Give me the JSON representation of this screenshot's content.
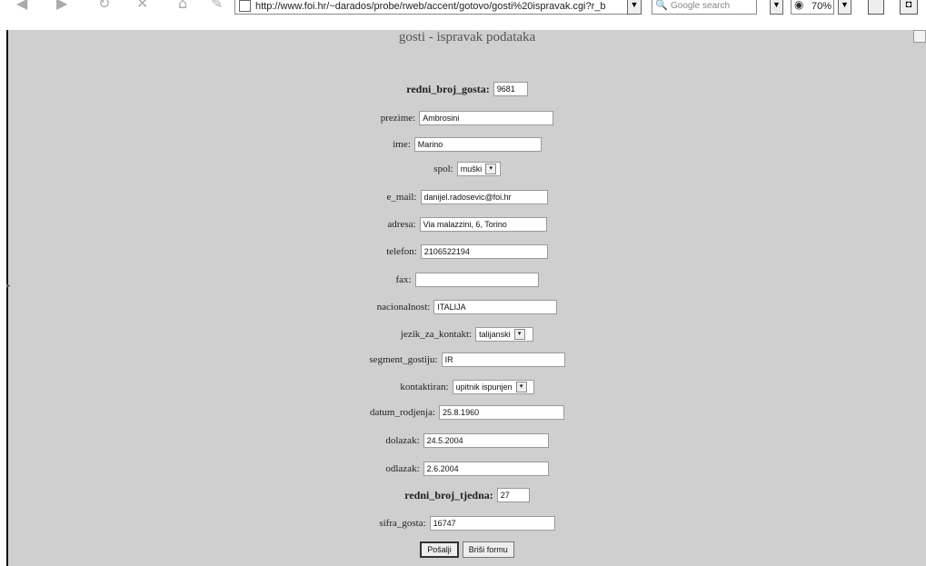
{
  "browser": {
    "url": "http://www.foi.hr/~darados/probe/rweb/accent/gotovo/gosti%20ispravak.cgi?r_b",
    "search_placeholder": "Google search",
    "zoom": "70%"
  },
  "page": {
    "title": "gosti - ispravak podataka"
  },
  "form": {
    "redni_broj_gosta": {
      "label": "redni_broj_gosta:",
      "value": "9681"
    },
    "prezime": {
      "label": "prezime:",
      "value": "Ambrosini"
    },
    "ime": {
      "label": "ime:",
      "value": "Marino"
    },
    "spol": {
      "label": "spol:",
      "value": "muški"
    },
    "e_mail": {
      "label": "e_mail:",
      "value": "danijel.radosevic@foi.hr"
    },
    "adresa": {
      "label": "adresa:",
      "value": "Via malazzini, 6, Torino"
    },
    "telefon": {
      "label": "telefon:",
      "value": "2106522194"
    },
    "fax": {
      "label": "fax:",
      "value": ""
    },
    "nacionalnost": {
      "label": "nacionalnost:",
      "value": "ITALIJA"
    },
    "jezik_za_kontakt": {
      "label": "jezik_za_kontakt:",
      "value": "talijanski"
    },
    "segment_gostiju": {
      "label": "segment_gostiju:",
      "value": "IR"
    },
    "kontaktiran": {
      "label": "kontaktiran:",
      "value": "upitnik ispunjen"
    },
    "datum_rodjenja": {
      "label": "datum_rodjenja:",
      "value": "25.8.1960"
    },
    "dolazak": {
      "label": "dolazak:",
      "value": "24.5.2004"
    },
    "odlazak": {
      "label": "odlazak:",
      "value": "2.6.2004"
    },
    "redni_broj_tjedna": {
      "label": "redni_broj_tjedna:",
      "value": "27"
    },
    "sifra_gosta": {
      "label": "sifra_gosta:",
      "value": "16747"
    }
  },
  "buttons": {
    "submit": "Pošalji",
    "reset": "Briši formu"
  }
}
